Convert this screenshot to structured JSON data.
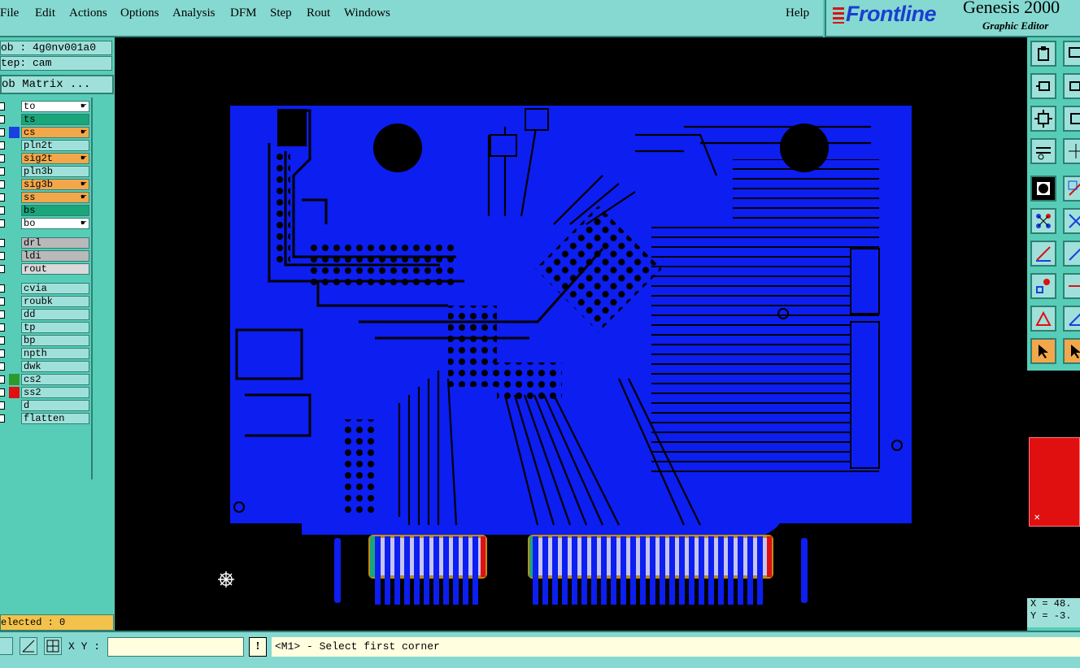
{
  "menu": {
    "file": "File",
    "edit": "Edit",
    "actions": "Actions",
    "options": "Options",
    "analysis": "Analysis",
    "dfm": "DFM",
    "step": "Step",
    "rout": "Rout",
    "windows": "Windows",
    "help": "Help"
  },
  "brand": {
    "logo": "Frontline",
    "product": "Genesis 2000",
    "subtitle": "Graphic Editor"
  },
  "job": {
    "job_line": "ob : 4g0nv001a0",
    "step_line": "tep: cam",
    "matrix_button": "ob Matrix ..."
  },
  "layers": [
    {
      "name": "to",
      "bg": "#ffffff",
      "swatch": "",
      "hand": true
    },
    {
      "name": "ts",
      "bg": "#1aa57a",
      "swatch": "",
      "hand": false
    },
    {
      "name": "cs",
      "bg": "#f3a74b",
      "swatch": "#1a3fe0",
      "hand": true
    },
    {
      "name": "pln2t",
      "bg": "#9fe1da",
      "swatch": "",
      "hand": false
    },
    {
      "name": "sig2t",
      "bg": "#f3a74b",
      "swatch": "",
      "hand": true
    },
    {
      "name": "pln3b",
      "bg": "#9fe1da",
      "swatch": "",
      "hand": false
    },
    {
      "name": "sig3b",
      "bg": "#f3a74b",
      "swatch": "",
      "hand": true
    },
    {
      "name": "ss",
      "bg": "#f3a74b",
      "swatch": "",
      "hand": true
    },
    {
      "name": "bs",
      "bg": "#1aa57a",
      "swatch": "",
      "hand": false
    },
    {
      "name": "bo",
      "bg": "#ffffff",
      "swatch": "",
      "hand": true
    },
    {
      "name": "drl",
      "bg": "#b9b9b9",
      "swatch": "",
      "hand": false
    },
    {
      "name": "ldi",
      "bg": "#b9b9b9",
      "swatch": "",
      "hand": false
    },
    {
      "name": "rout",
      "bg": "#d9d9d9",
      "swatch": "",
      "hand": false
    },
    {
      "name": "cvia",
      "bg": "#9fe1da",
      "swatch": "",
      "hand": false
    },
    {
      "name": "roubk",
      "bg": "#9fe1da",
      "swatch": "",
      "hand": false
    },
    {
      "name": "dd",
      "bg": "#9fe1da",
      "swatch": "",
      "hand": false
    },
    {
      "name": "tp",
      "bg": "#9fe1da",
      "swatch": "",
      "hand": false
    },
    {
      "name": "bp",
      "bg": "#9fe1da",
      "swatch": "",
      "hand": false
    },
    {
      "name": "npth",
      "bg": "#9fe1da",
      "swatch": "",
      "hand": false
    },
    {
      "name": "dwk",
      "bg": "#9fe1da",
      "swatch": "",
      "hand": false
    },
    {
      "name": "cs2",
      "bg": "#9fe1da",
      "swatch": "#2e9a2e",
      "hand": false
    },
    {
      "name": "ss2",
      "bg": "#9fe1da",
      "swatch": "#e01010",
      "hand": false
    },
    {
      "name": "d",
      "bg": "#9fe1da",
      "swatch": "",
      "hand": false
    },
    {
      "name": "flatten",
      "bg": "#9fe1da",
      "swatch": "",
      "hand": false
    }
  ],
  "selected": "elected : 0",
  "coords": {
    "x": "X = 48.",
    "y": "Y = -3."
  },
  "status": {
    "xy_label": "X Y :",
    "xy_value": "",
    "bang": "!",
    "message": "<M1> - Select first corner"
  },
  "colors": {
    "board": "#0c1ef0",
    "canvas": "#000000",
    "ui": "#57cdb8"
  }
}
